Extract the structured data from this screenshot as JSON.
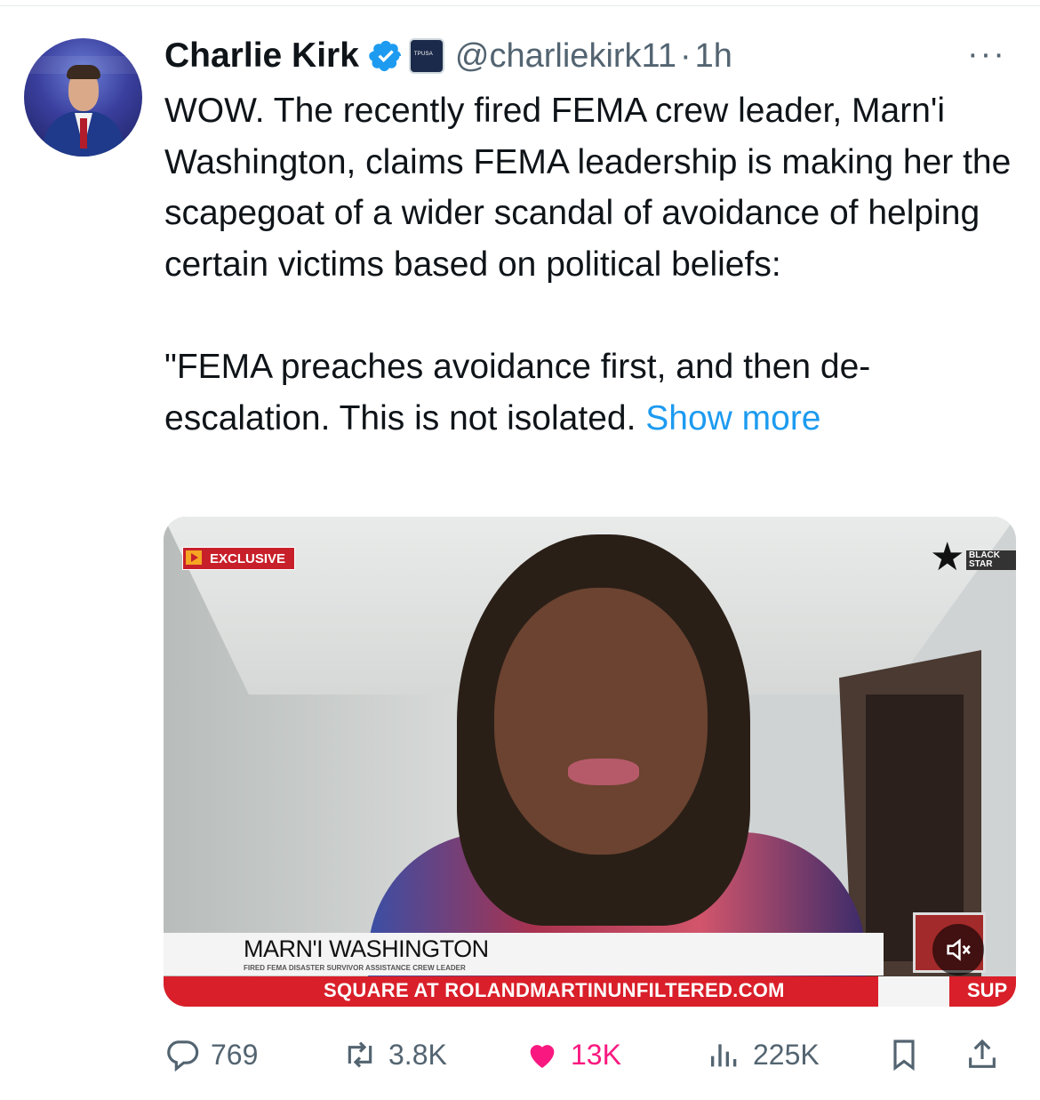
{
  "tweet": {
    "author_name": "Charlie Kirk",
    "handle": "@charliekirk11",
    "separator": "·",
    "time": "1h",
    "text_paragraph_1": "WOW. The recently fired FEMA crew leader, Marn'i Washington, claims FEMA leadership is making her the scapegoat of a wider scandal of avoidance of helping certain victims based on political beliefs:",
    "text_paragraph_2": "\"FEMA preaches avoidance first, and then de-escalation. This is not isolated.",
    "show_more": "Show more"
  },
  "video": {
    "badge": "EXCLUSIVE",
    "network_logo_text": "BLACK STAR",
    "lower_third_name": "MARN'I WASHINGTON",
    "lower_third_title": "FIRED FEMA DISASTER SURVIVOR ASSISTANCE CREW LEADER",
    "ticker_text": "SQUARE AT ROLANDMARTINUNFILTERED.COM",
    "ticker_text_end": "SUP",
    "muted": true
  },
  "actions": {
    "replies": "769",
    "reposts": "3.8K",
    "likes": "13K",
    "views": "225K"
  },
  "colors": {
    "link": "#1d9bf0",
    "like": "#f91880",
    "muted_text": "#536471",
    "verified": "#1d9bf0"
  },
  "icons": [
    "verified-badge-icon",
    "affiliate-badge-icon",
    "more-icon",
    "reply-icon",
    "repost-icon",
    "like-icon",
    "views-icon",
    "bookmark-icon",
    "share-icon",
    "mute-icon"
  ]
}
